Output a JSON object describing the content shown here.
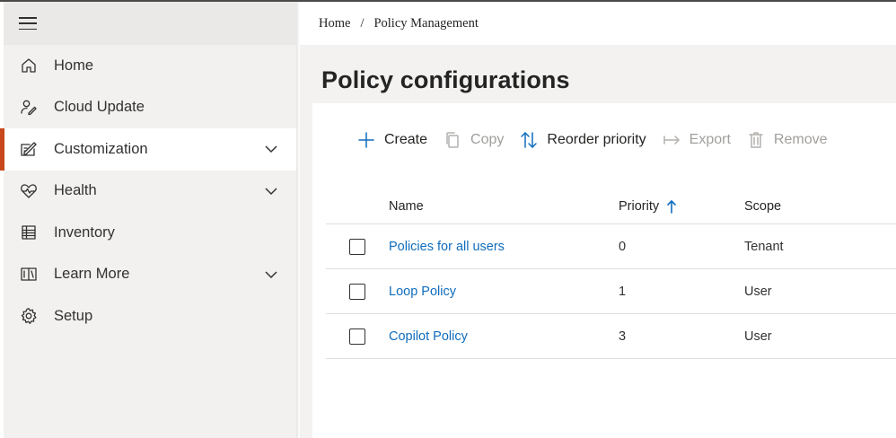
{
  "sidebar": {
    "items": [
      {
        "label": "Home",
        "icon": "home-icon",
        "expandable": false,
        "active": false
      },
      {
        "label": "Cloud Update",
        "icon": "person-sync-icon",
        "expandable": false,
        "active": false
      },
      {
        "label": "Customization",
        "icon": "edit-settings-icon",
        "expandable": true,
        "active": true
      },
      {
        "label": "Health",
        "icon": "heart-pulse-icon",
        "expandable": true,
        "active": false
      },
      {
        "label": "Inventory",
        "icon": "table-icon",
        "expandable": false,
        "active": false
      },
      {
        "label": "Learn More",
        "icon": "book-icon",
        "expandable": true,
        "active": false
      },
      {
        "label": "Setup",
        "icon": "gear-icon",
        "expandable": false,
        "active": false
      }
    ]
  },
  "breadcrumb": {
    "home": "Home",
    "separator": "/",
    "current": "Policy Management"
  },
  "page": {
    "title": "Policy configurations"
  },
  "toolbar": {
    "create": "Create",
    "copy": "Copy",
    "reorder": "Reorder priority",
    "export": "Export",
    "remove": "Remove"
  },
  "table": {
    "headers": {
      "name": "Name",
      "priority": "Priority",
      "scope": "Scope"
    },
    "sort": {
      "column": "Priority",
      "direction": "ascending"
    },
    "rows": [
      {
        "name": "Policies for all users",
        "priority": "0",
        "scope": "Tenant",
        "checked": false
      },
      {
        "name": "Loop Policy",
        "priority": "1",
        "scope": "User",
        "checked": false
      },
      {
        "name": "Copilot Policy",
        "priority": "3",
        "scope": "User",
        "checked": false
      }
    ]
  },
  "colors": {
    "accent": "#0f6cbd",
    "active_indicator": "#c8471b",
    "sidebar_bg": "#f2f1f0"
  }
}
